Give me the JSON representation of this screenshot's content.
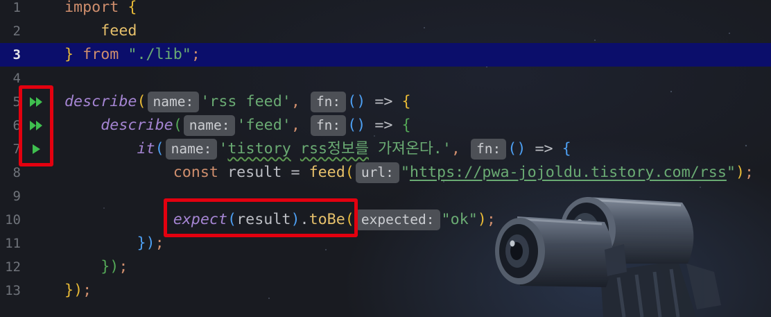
{
  "editor": {
    "lines": [
      {
        "number": "1",
        "tokens": [
          {
            "t": "import",
            "k": "keyword"
          },
          {
            "t": " ",
            "k": "plain"
          },
          {
            "t": "{",
            "k": "bracket_1"
          }
        ]
      },
      {
        "number": "2",
        "tokens": [
          {
            "t": "    ",
            "k": "plain"
          },
          {
            "t": "feed",
            "k": "function"
          }
        ]
      },
      {
        "number": "3",
        "current": true,
        "tokens": [
          {
            "t": "}",
            "k": "bracket_1"
          },
          {
            "t": " ",
            "k": "plain"
          },
          {
            "t": "from",
            "k": "keyword"
          },
          {
            "t": " ",
            "k": "plain"
          },
          {
            "t": "\"./lib\"",
            "k": "string"
          },
          {
            "t": ";",
            "k": "punct"
          }
        ]
      },
      {
        "number": "4",
        "tokens": []
      },
      {
        "number": "5",
        "run_icon": "run-all-tests-icon",
        "tokens": [
          {
            "t": "describe",
            "k": "test_function"
          },
          {
            "t": "(",
            "k": "bracket_1"
          },
          {
            "t": "name:",
            "k": "hint"
          },
          {
            "t": "'rss feed'",
            "k": "string"
          },
          {
            "t": ",",
            "k": "punct"
          },
          {
            "t": " ",
            "k": "plain"
          },
          {
            "t": "fn:",
            "k": "hint"
          },
          {
            "t": "()",
            "k": "bracket_3"
          },
          {
            "t": " => ",
            "k": "plain"
          },
          {
            "t": "{",
            "k": "bracket_1"
          }
        ]
      },
      {
        "number": "6",
        "run_icon": "run-all-tests-icon",
        "tokens": [
          {
            "t": "    ",
            "k": "plain"
          },
          {
            "t": "describe",
            "k": "test_function"
          },
          {
            "t": "(",
            "k": "bracket_2"
          },
          {
            "t": "name:",
            "k": "hint"
          },
          {
            "t": "'feed'",
            "k": "string"
          },
          {
            "t": ",",
            "k": "punct"
          },
          {
            "t": " ",
            "k": "plain"
          },
          {
            "t": "fn:",
            "k": "hint"
          },
          {
            "t": "()",
            "k": "bracket_3"
          },
          {
            "t": " => ",
            "k": "plain"
          },
          {
            "t": "{",
            "k": "bracket_2"
          }
        ]
      },
      {
        "number": "7",
        "run_icon": "run-test-icon",
        "tokens": [
          {
            "t": "        ",
            "k": "plain"
          },
          {
            "t": "it",
            "k": "test_function"
          },
          {
            "t": "(",
            "k": "bracket_3"
          },
          {
            "t": "name:",
            "k": "hint"
          },
          {
            "t": "'",
            "k": "string"
          },
          {
            "t": "tistory",
            "k": "string",
            "typo": true
          },
          {
            "t": " ",
            "k": "string"
          },
          {
            "t": "rss정보를",
            "k": "string",
            "typo": true
          },
          {
            "t": " 가져온다.'",
            "k": "string"
          },
          {
            "t": ",",
            "k": "punct"
          },
          {
            "t": " ",
            "k": "plain"
          },
          {
            "t": "fn:",
            "k": "hint"
          },
          {
            "t": "()",
            "k": "bracket_3"
          },
          {
            "t": " => ",
            "k": "plain"
          },
          {
            "t": "{",
            "k": "bracket_3"
          }
        ]
      },
      {
        "number": "8",
        "tokens": [
          {
            "t": "            ",
            "k": "plain"
          },
          {
            "t": "const",
            "k": "keyword"
          },
          {
            "t": " result = ",
            "k": "plain"
          },
          {
            "t": "feed",
            "k": "function"
          },
          {
            "t": "(",
            "k": "bracket_1"
          },
          {
            "t": "url:",
            "k": "hint"
          },
          {
            "t": "\"",
            "k": "string"
          },
          {
            "t": "https://pwa-jojoldu.tistory.com/rss",
            "k": "url"
          },
          {
            "t": "\"",
            "k": "string"
          },
          {
            "t": ")",
            "k": "bracket_1"
          },
          {
            "t": ";",
            "k": "punct"
          }
        ]
      },
      {
        "number": "9",
        "tokens": []
      },
      {
        "number": "10",
        "tokens": [
          {
            "t": "            ",
            "k": "plain"
          },
          {
            "t": "expect",
            "k": "test_function"
          },
          {
            "t": "(",
            "k": "bracket_3"
          },
          {
            "t": "result",
            "k": "plain"
          },
          {
            "t": ")",
            "k": "bracket_3"
          },
          {
            "t": ".",
            "k": "plain"
          },
          {
            "t": "toBe",
            "k": "function"
          },
          {
            "t": "(",
            "k": "bracket_1"
          },
          {
            "t": "expected:",
            "k": "hint"
          },
          {
            "t": "\"ok\"",
            "k": "string"
          },
          {
            "t": ")",
            "k": "bracket_1"
          },
          {
            "t": ";",
            "k": "punct"
          }
        ]
      },
      {
        "number": "11",
        "tokens": [
          {
            "t": "        ",
            "k": "plain"
          },
          {
            "t": "}",
            "k": "bracket_3"
          },
          {
            "t": ")",
            "k": "bracket_3"
          },
          {
            "t": ";",
            "k": "punct"
          }
        ]
      },
      {
        "number": "12",
        "tokens": [
          {
            "t": "    ",
            "k": "plain"
          },
          {
            "t": "}",
            "k": "bracket_2"
          },
          {
            "t": ")",
            "k": "bracket_2"
          },
          {
            "t": ";",
            "k": "punct"
          }
        ]
      },
      {
        "number": "13",
        "tokens": [
          {
            "t": "}",
            "k": "bracket_1"
          },
          {
            "t": ")",
            "k": "bracket_1"
          },
          {
            "t": ";",
            "k": "punct"
          }
        ]
      }
    ]
  },
  "colors": {
    "background": "#191b21",
    "current_line": "#0b0e6b",
    "line_number": "#6f737a",
    "line_number_current": "#e6e7ea",
    "plain": "#bcbec4",
    "keyword": "#cf8e6d",
    "function": "#e6c06b",
    "string": "#6aab73",
    "test_function": "#a585d3",
    "hint_bg": "#4d5056",
    "hint_text": "#ccced2",
    "bracket_1": "#e8ba36",
    "bracket_2": "#54a857",
    "bracket_3": "#4d9ff2",
    "run_icon": "#3fbf4f",
    "annotation": "#e3000f",
    "typo_underline": "#5e9a52"
  }
}
